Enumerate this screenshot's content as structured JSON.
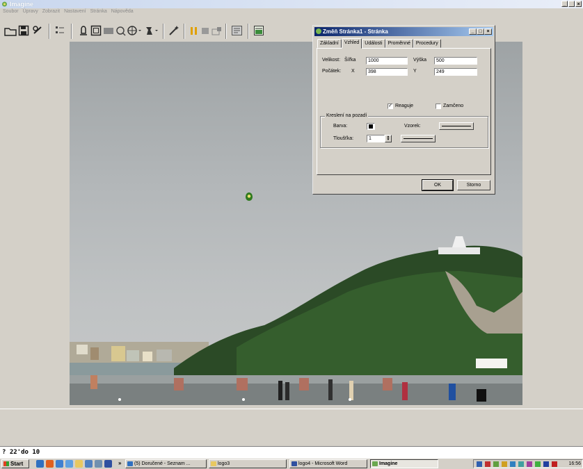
{
  "app": {
    "title": "Imagine",
    "menu": [
      "Soubor",
      "Úpravy",
      "Zobrazit",
      "Nastavení",
      "Stránka",
      "Nápověda"
    ],
    "window_controls": [
      "_",
      " ",
      "×"
    ]
  },
  "dialog": {
    "title": "Změň Stránka1 - Stránka",
    "controls": [
      "_",
      "□",
      "×"
    ],
    "tabs": [
      "Základní",
      "Vzhled",
      "Události",
      "Proměnné",
      "Procedury"
    ],
    "selected_tab": "Vzhled",
    "velikost_label": "Velikost:",
    "sirka_label": "Šířka",
    "sirka_value": "1000",
    "vyska_label": "Výška",
    "vyska_value": "500",
    "pocatek_label": "Počátek:",
    "x_label": "X",
    "x_value": "398",
    "y_label": "Y",
    "y_value": "249",
    "reaguje_label": "Reaguje",
    "reaguje_checked": "✓",
    "zamceno_label": "Zamčeno",
    "group_label": "Kreslení na pozadí",
    "barva_label": "Barva:",
    "vzorek_label": "Vzorek:",
    "tloustka_label": "Tloušťka:",
    "tloustka_value": "1",
    "ok_label": "OK",
    "storno_label": "Storno"
  },
  "command_line": "? 22'do 10",
  "taskbar": {
    "start_label": "Start",
    "chevron": "»",
    "tasks": [
      "(5) Doručené - Seznam ...",
      "logo3",
      "logo4 - Microsoft Word",
      "Imagine"
    ],
    "clock": "16:56"
  },
  "colors": {
    "title_active": "#0a246a",
    "title_inactive": "#c9d7ee",
    "face": "#d4d0c8"
  }
}
